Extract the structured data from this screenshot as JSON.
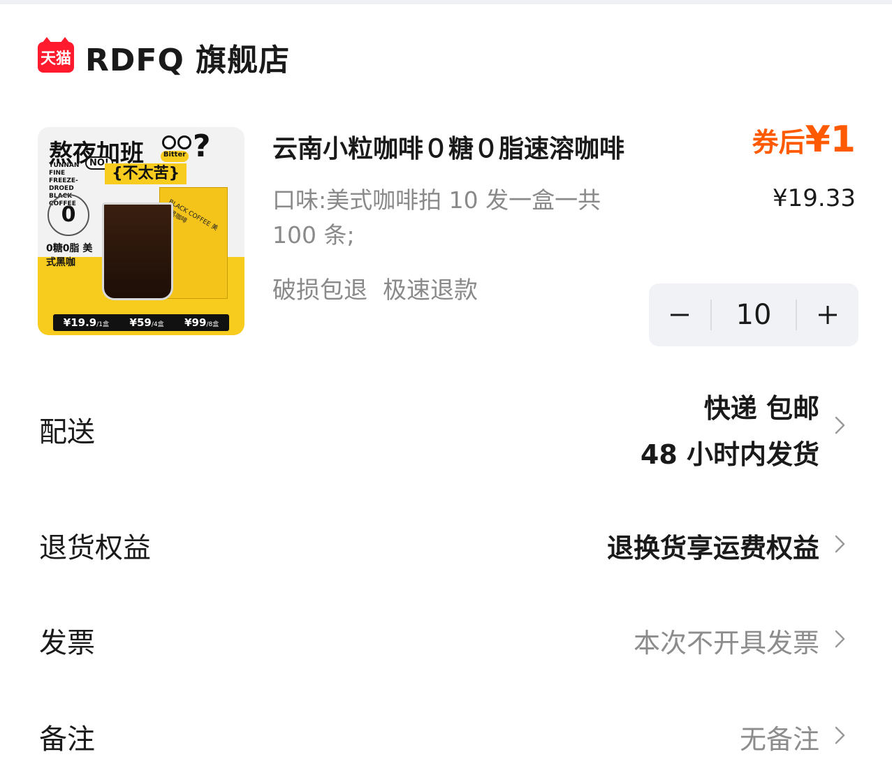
{
  "store": {
    "badge": "天猫",
    "name": "RDFQ 旗舰店"
  },
  "product": {
    "title": "云南小粒咖啡０糖０脂速溶咖啡",
    "coupon_label": "券后",
    "coupon_price": "¥1",
    "flavor": "口味:美式咖啡拍 10 发一盒一共 100 条;",
    "price": "¥19.33",
    "tags": [
      "破损包退",
      "极速退款"
    ],
    "quantity": "10",
    "image": {
      "headline": "熬夜加班",
      "question": "?",
      "bitter": "Bitter",
      "no": "NO!",
      "not_bitter": "{不太苦}",
      "english": "YUNNAN FINE FREEZE-DROED BLACK COFFEE",
      "circle": "0",
      "zero_text": "0糖0脂 美式黑咖",
      "box_label": "BLACK COFFEE 美式黑咖啡",
      "prices": [
        {
          "price": "¥19.9",
          "unit": "/1盒"
        },
        {
          "price": "¥59",
          "unit": "/4盒"
        },
        {
          "price": "¥99",
          "unit": "/8盒"
        }
      ]
    }
  },
  "rows": {
    "delivery": {
      "label": "配送",
      "line1": "快递 包邮",
      "line2": "48 小时内发货"
    },
    "returns": {
      "label": "退货权益",
      "value": "退换货享运费权益"
    },
    "invoice": {
      "label": "发票",
      "value": "本次不开具发票"
    },
    "note": {
      "label": "备注",
      "value": "无备注"
    }
  },
  "icons": {
    "chevron": "chevron-right-icon",
    "minus": "minus-icon",
    "plus": "plus-icon"
  },
  "colors": {
    "accent": "#ff5a00",
    "tmall": "#ff1a2e"
  }
}
